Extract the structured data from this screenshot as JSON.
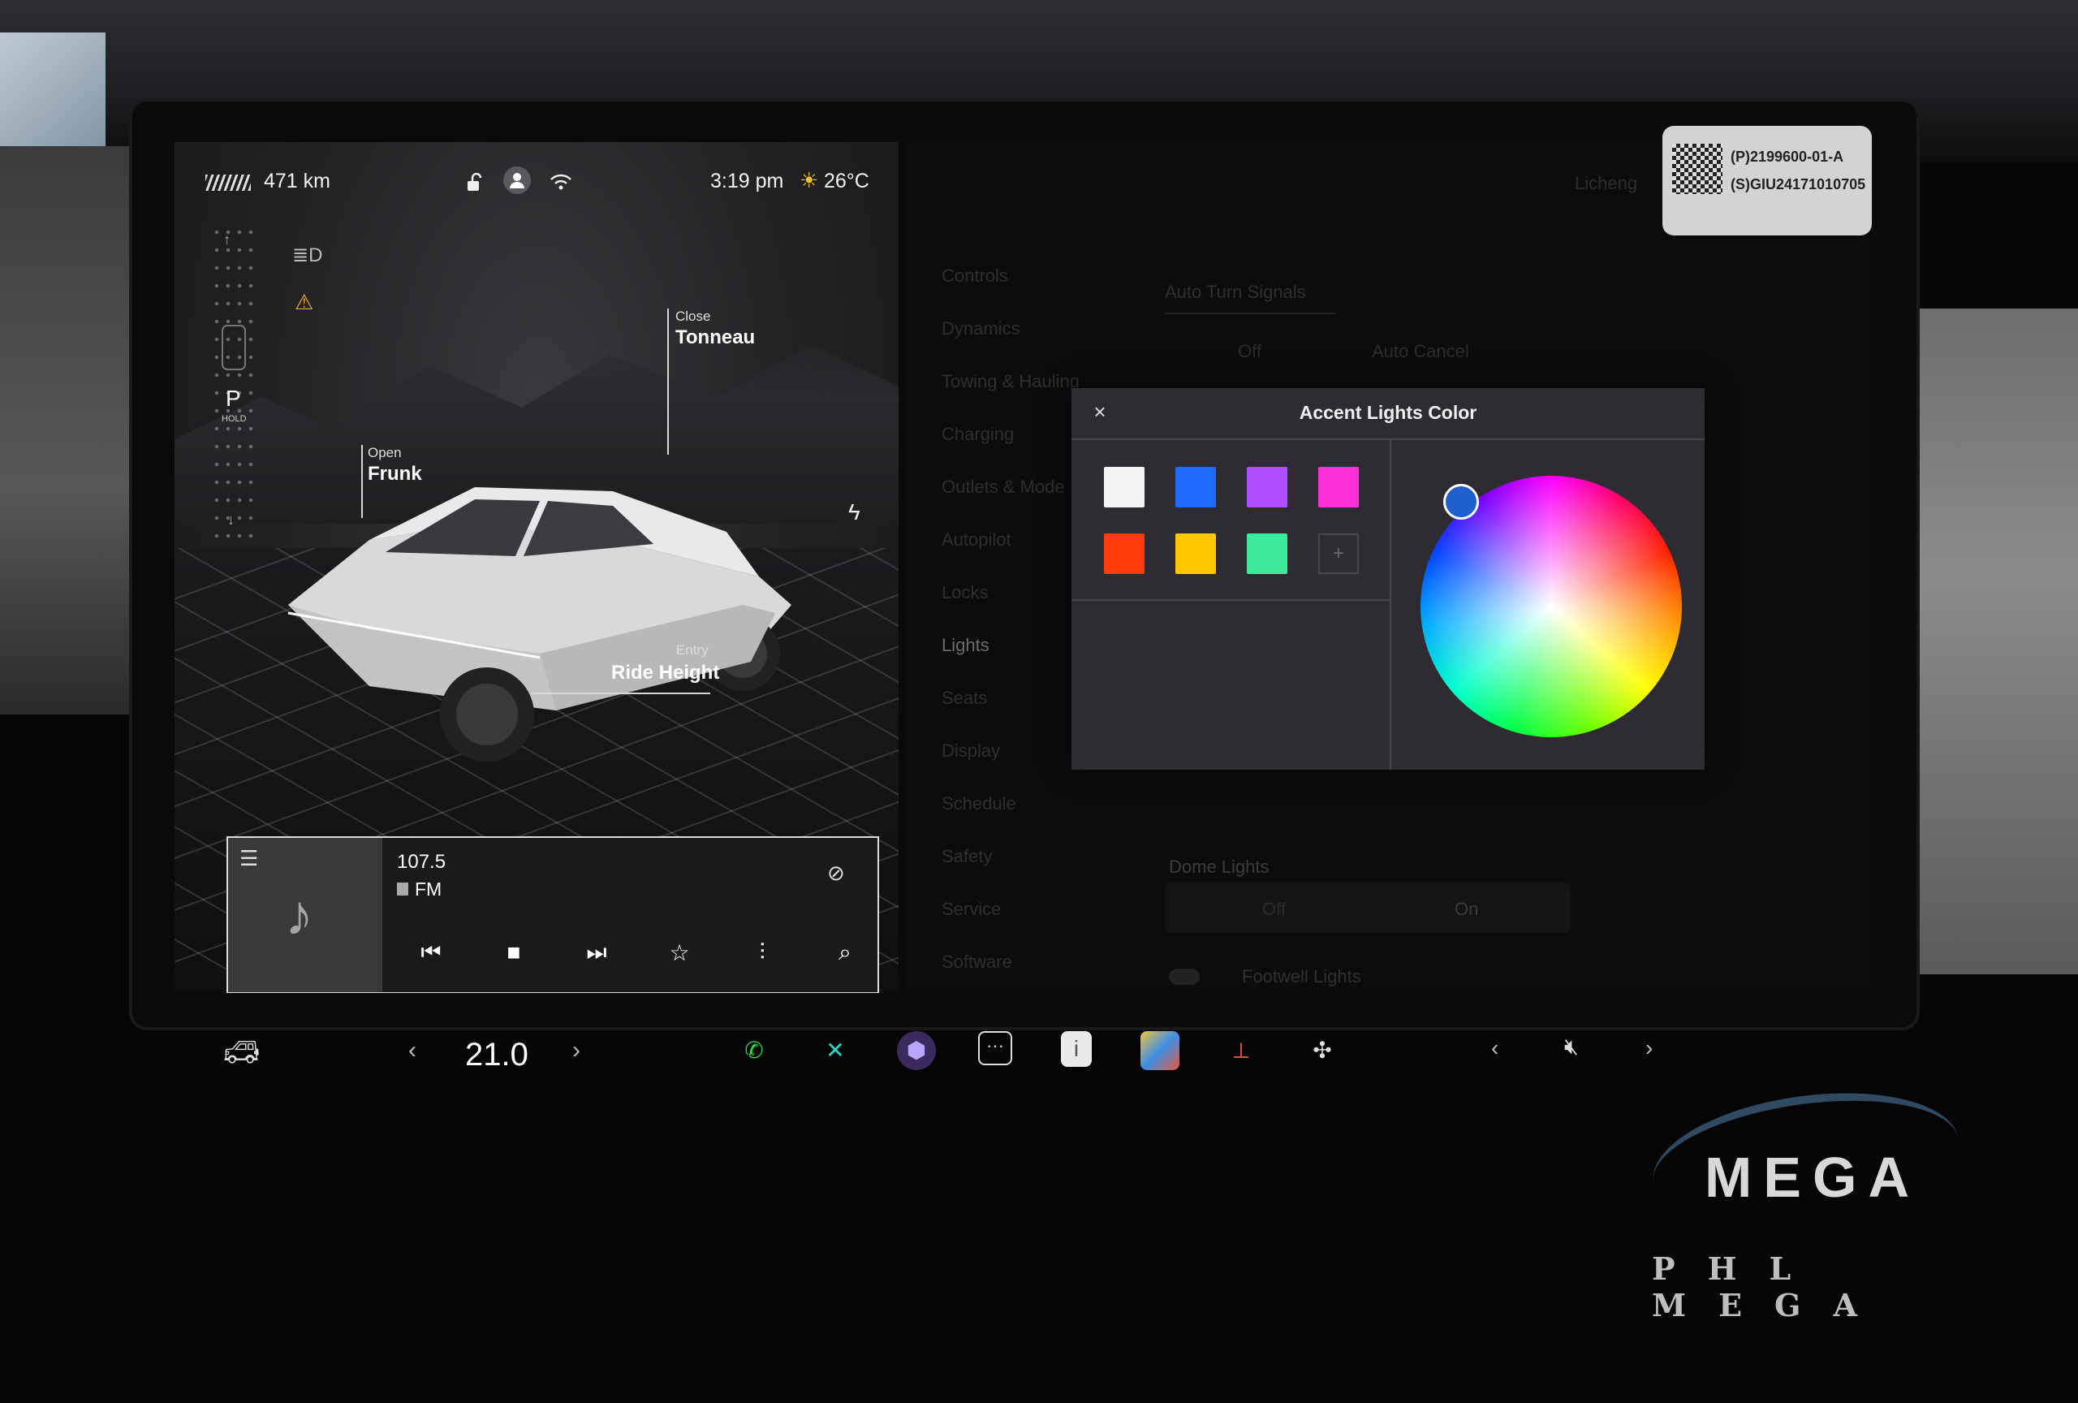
{
  "vehicle": {
    "range": "471 km",
    "time": "3:19 pm",
    "temperature": "26°C",
    "gear": "P",
    "gear_hold": "HOLD",
    "callouts": {
      "tonneau_action": "Close",
      "tonneau_label": "Tonneau",
      "frunk_action": "Open",
      "frunk_label": "Frunk",
      "ride_action": "Entry",
      "ride_label": "Ride Height"
    }
  },
  "media": {
    "frequency": "107.5",
    "band": "FM",
    "controls": [
      "previous",
      "stop",
      "next",
      "favorite",
      "equalizer",
      "search"
    ]
  },
  "settings": {
    "profile": "Licheng",
    "menu": [
      "Controls",
      "Dynamics",
      "Towing & Hauling",
      "Charging",
      "Outlets & Mode",
      "Autopilot",
      "Locks",
      "Lights",
      "Seats",
      "Display",
      "Schedule",
      "Safety",
      "Service",
      "Software"
    ],
    "active_menu": "Lights",
    "auto_turn_signals": "Auto Turn Signals",
    "options": {
      "off": "Off",
      "auto_cancel": "Auto Cancel"
    },
    "dome_lights": "Dome Lights",
    "dome_off": "Off",
    "dome_on": "On",
    "footwell_lights": "Footwell Lights"
  },
  "color_dialog": {
    "title": "Accent Lights Color",
    "close_symbol": "×",
    "add_symbol": "+",
    "swatches": [
      "#f4f4f4",
      "#1f6bff",
      "#b04cff",
      "#ff2fd8",
      "#ff3b0a",
      "#ffc700",
      "#3fe89a"
    ],
    "selected_color": "#1f5fcc"
  },
  "dock": {
    "cabin_temp": "21.0",
    "apps": [
      "phone",
      "shuffle",
      "camera",
      "more",
      "manual",
      "photos",
      "joystick",
      "fan"
    ],
    "volume_state": "muted"
  },
  "sticker": {
    "line1": "(P)2199600-01-A",
    "line2": "(S)GIU24171010705"
  },
  "watermark": {
    "brand": "MEGA",
    "sub": "PHL MEGA"
  },
  "colors": {
    "accent_orange": "#e7a63a",
    "dock_phone": "#2fd44a",
    "dock_shuffle": "#2ad7c7"
  }
}
